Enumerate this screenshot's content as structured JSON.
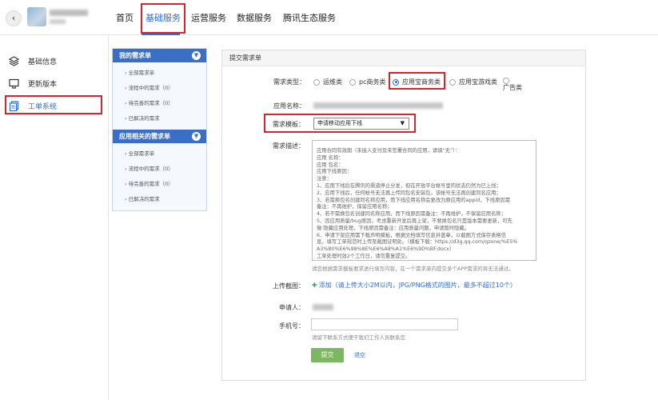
{
  "header": {
    "back_icon": "chevron-left-icon",
    "nav": [
      "首页",
      "基础服务",
      "运营服务",
      "数据服务",
      "腾讯生态服务"
    ],
    "active_nav": "基础服务",
    "accent": "#2f6fd4",
    "highlight": "#d4262f"
  },
  "sidebar": {
    "items": [
      {
        "label": "基础信息",
        "icon": "layers-icon"
      },
      {
        "label": "更新版本",
        "icon": "monitor-icon"
      },
      {
        "label": "工单系统",
        "icon": "documents-icon"
      }
    ],
    "active": "工单系统"
  },
  "requests": {
    "groups": [
      {
        "title": "我的需求单",
        "items": [
          "全部需求单",
          "流程中的需求（0）",
          "待完善的需求（0）",
          "已解决的需求"
        ]
      },
      {
        "title": "应用相关的需求单",
        "items": [
          "全部需求单",
          "流程中的需求（0）",
          "待完善的需求（0）",
          "已解决的需求"
        ]
      }
    ],
    "toggle_icon": "chevron-down-icon"
  },
  "form": {
    "title": "提交需求单",
    "type_label": "需求类型：",
    "type_options": [
      "运维类",
      "pc商务类",
      "应用宝商务类",
      "应用宝游戏类",
      "广告类"
    ],
    "type_selected": "应用宝商务类",
    "app_name_label": "应用名称：",
    "template_label": "需求模板：",
    "template_value": "申请移动应用下线",
    "desc_label": "需求描述：",
    "desc_lines": [
      "应用合同有效期（未接入支付及未签署合同的应用，请填“无”）：",
      "应用  名称：",
      "应用  包名：",
      "应用下线原因：",
      "注意：",
      "1、应用下线后在腾讯的渠道停止分发，但在开放平台帐号里的状态仍然为已上线；",
      "2、应用下线后，任何帐号无法再上传同包名安装包，该帐号无法再创建同名应用；",
      "3、若需换包名创建同名称应用，而下线应用名称会更改为原应用的appid，下线原因需",
      "备注：不再维护，保留应用名称；",
      "4、若不需换包名创建同名称应用，而下线原因需备注：不再维护，不保留应用名称；",
      "5、因应用质量/bug原因，考虑重新开发后再上架，不要换包名只是版本需要更新，可先",
      "做 隐藏应用处理，下线原因需备注：应用质量问题，申请暂时隐藏。",
      "6、申请下架应用需下载声明模板，根据文档填写信息并盖章，以截图方式保存表格信",
      "息，填写工单规范时上传至截图证明处。（模板下载：https://d3g.qq.com/qzone/%E5%",
      "A3%B0%E6%98%8E%E6%A8%A1%E6%9D%BF.docx）",
      "工单处理时效2个工作日，请勿重复提交。"
    ],
    "desc_hint": "请您根据需求模板要求进行填写内容，在一个需求单内提交多个APP需求的将无法通过。",
    "upload_label": "上传截图：",
    "upload_link": "添加",
    "upload_note": "（请上传大小2M以内，JPG/PNG格式的图片，最多不超过10个）",
    "applicant_label": "申请人：",
    "phone_label": "手机号：",
    "phone_value": "",
    "phone_hint": "请留下联系方式便于我们工作人员联系您",
    "submit": "提交",
    "cancel": "退空"
  }
}
